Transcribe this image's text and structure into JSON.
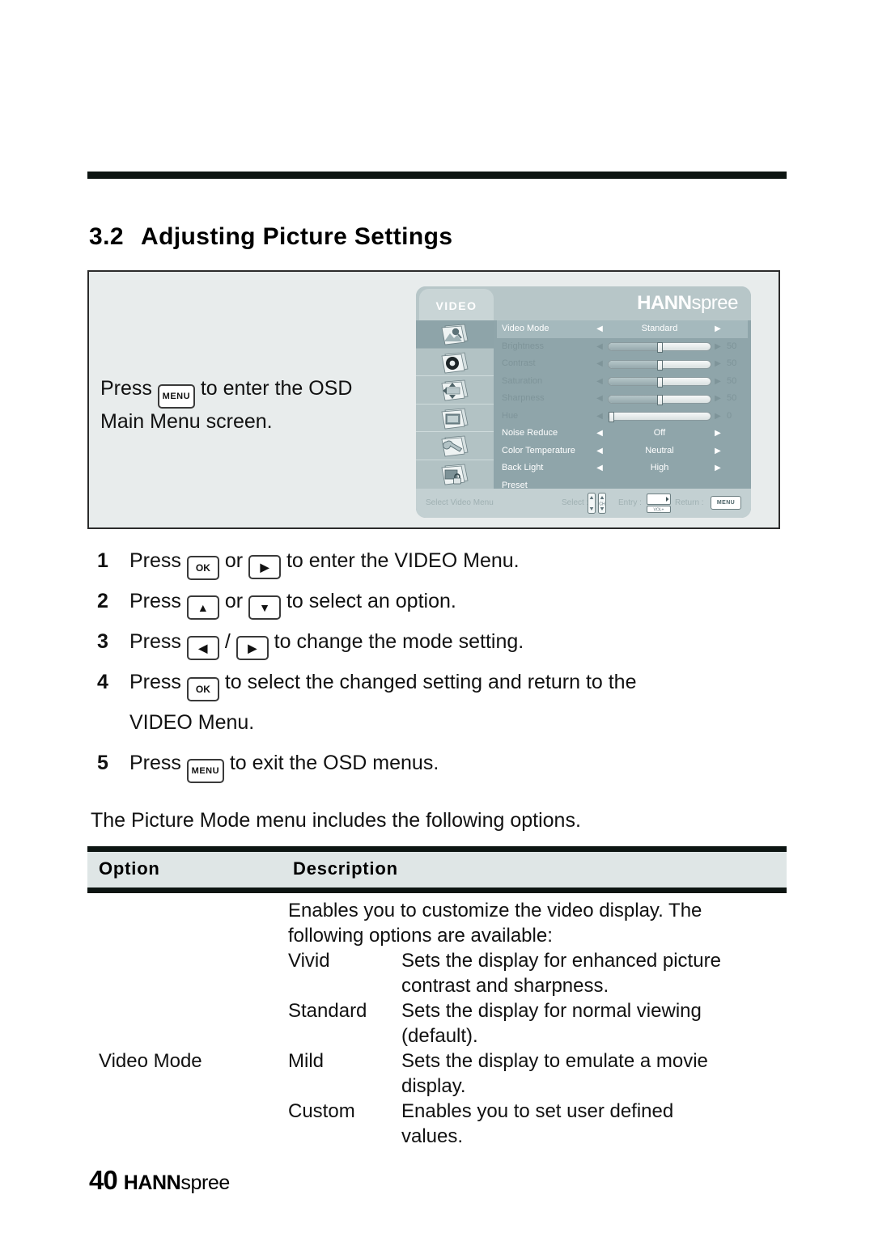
{
  "document": {
    "section_number": "3.2",
    "section_title": "Adjusting Picture Settings",
    "page_number": "40",
    "brand_bold": "HANN",
    "brand_light": "spree"
  },
  "illustration": {
    "caption_before": "Press",
    "caption_key": "MENU",
    "caption_after_line1": "to enter the OSD",
    "caption_line2": "Main Menu screen."
  },
  "osd": {
    "tab_label": "VIDEO",
    "brand_bold": "HANN",
    "brand_light": "spree",
    "sidebar_icons": [
      "picture-video-icon",
      "audio-speaker-icon",
      "adjust-position-icon",
      "screen-display-icon",
      "setup-wrench-icon",
      "lock-security-icon"
    ],
    "rows": [
      {
        "label": "Video Mode",
        "type": "choice",
        "value": "Standard",
        "state": "highlight",
        "arrow_left": "◀",
        "arrow_right": "▶"
      },
      {
        "label": "Brightness",
        "type": "slider",
        "value": "50",
        "percent": 50,
        "state": "dim",
        "arrow_left": "◀",
        "arrow_right": "▶"
      },
      {
        "label": "Contrast",
        "type": "slider",
        "value": "50",
        "percent": 50,
        "state": "dim",
        "arrow_left": "◀",
        "arrow_right": "▶"
      },
      {
        "label": "Saturation",
        "type": "slider",
        "value": "50",
        "percent": 50,
        "state": "dim",
        "arrow_left": "◀",
        "arrow_right": "▶"
      },
      {
        "label": "Sharpness",
        "type": "slider",
        "value": "50",
        "percent": 50,
        "state": "dim",
        "arrow_left": "◀",
        "arrow_right": "▶"
      },
      {
        "label": "Hue",
        "type": "slider",
        "value": "0",
        "percent": 2,
        "state": "dim",
        "arrow_left": "◀",
        "arrow_right": "▶"
      },
      {
        "label": "Noise Reduce",
        "type": "choice",
        "value": "Off",
        "state": "normal",
        "arrow_left": "◀",
        "arrow_right": "▶"
      },
      {
        "label": "Color Temperature",
        "type": "choice",
        "value": "Neutral",
        "state": "normal",
        "arrow_left": "◀",
        "arrow_right": "▶"
      },
      {
        "label": "Back Light",
        "type": "choice",
        "value": "High",
        "state": "normal",
        "arrow_left": "◀",
        "arrow_right": "▶"
      },
      {
        "label": "Preset",
        "type": "plain",
        "value": "",
        "state": "normal",
        "arrow_left": "",
        "arrow_right": ""
      }
    ],
    "footer": {
      "hint": "Select Video Menu",
      "select_label": "Select :",
      "entry_label": "Entry :",
      "return_label": "Return :",
      "return_button": "MENU",
      "entry_button_sub": "VOL+"
    }
  },
  "steps": [
    {
      "index": "1",
      "parts": [
        "Press",
        "key:OK",
        "or",
        "key:▶",
        "to enter the VIDEO Menu."
      ]
    },
    {
      "index": "2",
      "parts": [
        "Press",
        "key:▲",
        "or",
        "key:▼",
        "to select an option."
      ]
    },
    {
      "index": "3",
      "parts": [
        "Press",
        "key:◀",
        "/",
        "key:▶",
        "to change the mode setting."
      ]
    },
    {
      "index": "4",
      "parts": [
        "Press",
        "key:OK",
        "to select the changed setting and return to the"
      ],
      "continuation": "VIDEO Menu."
    },
    {
      "index": "5",
      "parts": [
        "Press",
        "key:MENU",
        "to exit the OSD menus."
      ]
    }
  ],
  "step_labels": {
    "s1_press": "Press",
    "s1_key1": "OK",
    "s1_or": "or",
    "s1_key2": "▶",
    "s1_tail": "to enter the VIDEO Menu.",
    "s2_press": "Press",
    "s2_key1": "▲",
    "s2_or": "or",
    "s2_key2": "▼",
    "s2_tail": "to select an option.",
    "s3_press": "Press",
    "s3_key1": "◀",
    "s3_sep": "/",
    "s3_key2": "▶",
    "s3_tail": "to change the mode setting.",
    "s4_press": "Press",
    "s4_key1": "OK",
    "s4_tail": "to select the changed setting and return to the",
    "s4_cont": "VIDEO Menu.",
    "s5_press": "Press",
    "s5_key1": "MENU",
    "s5_tail": "to exit the OSD menus.",
    "idx1": "1",
    "idx2": "2",
    "idx3": "3",
    "idx4": "4",
    "idx5": "5"
  },
  "table": {
    "intro": "The Picture Mode menu includes the following options.",
    "headers": {
      "option": "Option",
      "description": "Description"
    },
    "row": {
      "option": "Video Mode",
      "intro_line1": "Enables you to customize the video display. The",
      "intro_line2": "following options are available:",
      "subrows": [
        {
          "name": "Vivid",
          "desc_line1": "Sets the display for enhanced picture",
          "desc_line2": "contrast and sharpness."
        },
        {
          "name": "Standard",
          "desc_line1": "Sets the display for normal viewing",
          "desc_line2": "(default)."
        },
        {
          "name": "Mild",
          "desc_line1": "Sets the display to emulate a movie",
          "desc_line2": "display."
        },
        {
          "name": "Custom",
          "desc_line1": "Enables you to set user defined",
          "desc_line2": "values."
        }
      ]
    }
  },
  "colors": {
    "osd_body": "#8fa5aa",
    "osd_chrome": "#c3d0d2",
    "osd_highlight": "#a5b9bd",
    "illus_bg": "#e8ecec",
    "rule": "#0d1512",
    "table_header_bg": "#dfe6e6"
  }
}
